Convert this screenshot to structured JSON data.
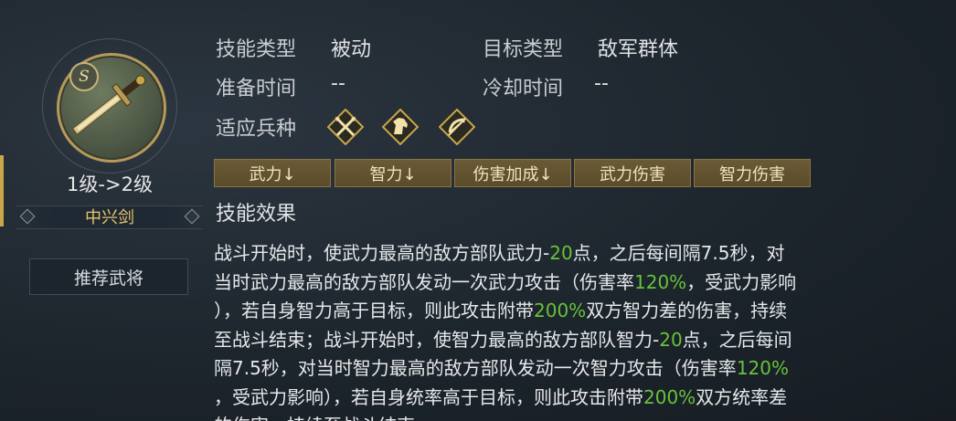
{
  "skill": {
    "grade": "S",
    "level_text": "1级->2级",
    "name": "中兴剑",
    "recommend_label": "推荐武将"
  },
  "info": {
    "skill_type_label": "技能类型",
    "skill_type_value": "被动",
    "target_type_label": "目标类型",
    "target_type_value": "敌军群体",
    "prep_time_label": "准备时间",
    "prep_time_value": "--",
    "cooldown_label": "冷却时间",
    "cooldown_value": "--",
    "troop_label": "适应兵种",
    "troop_icons": [
      "spear-icon",
      "cavalry-icon",
      "archer-icon"
    ]
  },
  "tags": [
    "武力↓",
    "智力↓",
    "伤害加成↓",
    "武力伤害",
    "智力伤害"
  ],
  "effect": {
    "title": "技能效果",
    "lines": [
      [
        {
          "t": "战斗开始时，使武力最高的敌方部队武力-"
        },
        {
          "t": "20",
          "hl": true
        },
        {
          "t": "点，之后每间隔7.5秒，对"
        }
      ],
      [
        {
          "t": "当时武力最高的敌方部队发动一次武力攻击（伤害率"
        },
        {
          "t": "120%",
          "hl": true
        },
        {
          "t": "，受武力影响"
        }
      ],
      [
        {
          "t": "），若自身智力高于目标，则此攻击附带"
        },
        {
          "t": "200%",
          "hl": true
        },
        {
          "t": "双方智力差的伤害，持续"
        }
      ],
      [
        {
          "t": "至战斗结束；战斗开始时，使智力最高的敌方部队智力-"
        },
        {
          "t": "20",
          "hl": true
        },
        {
          "t": "点，之后每间"
        }
      ],
      [
        {
          "t": "隔7.5秒，对当时智力最高的敌方部队发动一次智力攻击（伤害率"
        },
        {
          "t": "120%",
          "hl": true
        }
      ],
      [
        {
          "t": "，受武力影响），若自身统率高于目标，则此攻击附带"
        },
        {
          "t": "200%",
          "hl": true
        },
        {
          "t": "双方统率差"
        }
      ],
      [
        {
          "t": "的伤害，持续至战斗结束。"
        }
      ]
    ]
  },
  "colors": {
    "highlight": "#67c23a",
    "gold": "#e7c56a",
    "tag_bg": "#6a5a35"
  }
}
